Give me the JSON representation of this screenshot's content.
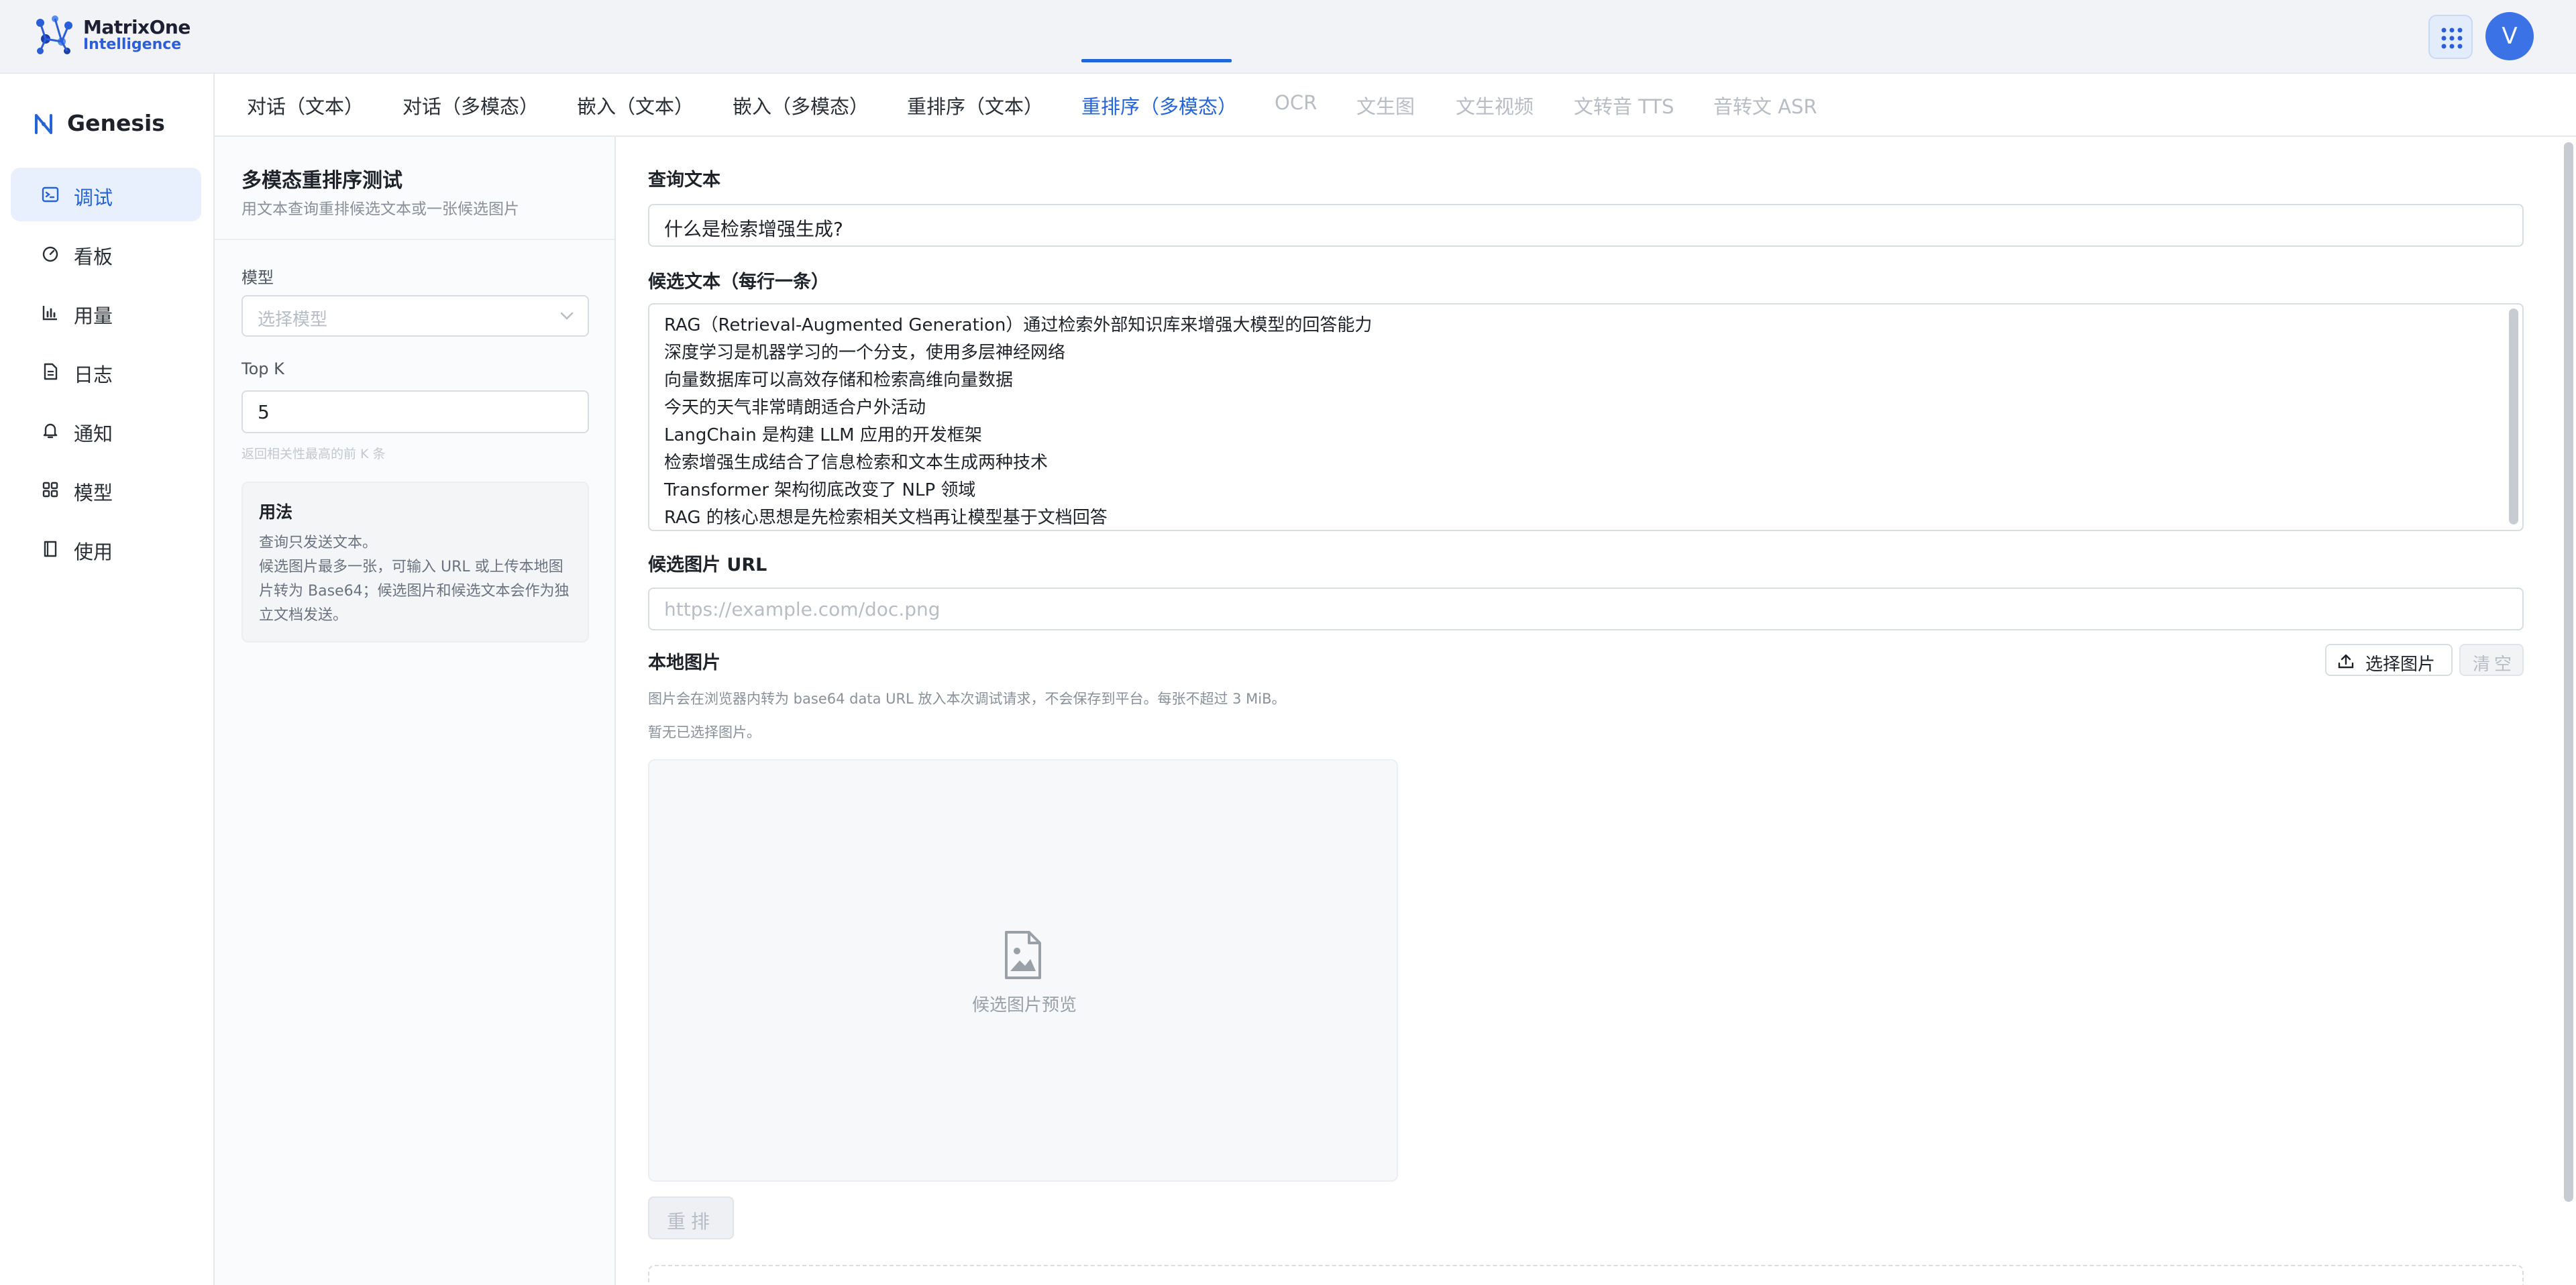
{
  "brand": {
    "logo_line1": "MatrixOne",
    "logo_line2": "Intelligence",
    "app_name": "Genesis"
  },
  "user": {
    "avatar_initial": "V"
  },
  "sidebar": {
    "items": [
      {
        "label": "调试",
        "icon": "terminal-icon",
        "active": true
      },
      {
        "label": "看板",
        "icon": "dashboard-gauge-icon"
      },
      {
        "label": "用量",
        "icon": "bar-chart-icon"
      },
      {
        "label": "日志",
        "icon": "document-icon"
      },
      {
        "label": "通知",
        "icon": "bell-icon"
      },
      {
        "label": "模型",
        "icon": "grid-icon"
      },
      {
        "label": "使用",
        "icon": "book-icon"
      }
    ]
  },
  "tabs": [
    {
      "label": "对话（文本）"
    },
    {
      "label": "对话（多模态）"
    },
    {
      "label": "嵌入（文本）"
    },
    {
      "label": "嵌入（多模态）"
    },
    {
      "label": "重排序（文本）"
    },
    {
      "label": "重排序（多模态）",
      "active": true
    },
    {
      "label": "OCR",
      "disabled": true
    },
    {
      "label": "文生图",
      "disabled": true
    },
    {
      "label": "文生视频",
      "disabled": true
    },
    {
      "label": "文转音 TTS",
      "disabled": true
    },
    {
      "label": "音转文 ASR",
      "disabled": true
    }
  ],
  "panel": {
    "title": "多模态重排序测试",
    "subtitle": "用文本查询重排候选文本或一张候选图片",
    "model_label": "模型",
    "model_placeholder": "选择模型",
    "topk_label": "Top K",
    "topk_value": "5",
    "topk_hint": "返回相关性最高的前 K 条",
    "usage_title": "用法",
    "usage_lines": [
      "查询只发送文本。",
      "候选图片最多一张，可输入 URL 或上传本地图",
      "片转为 Base64；候选图片和候选文本会作为独",
      "立文档发送。"
    ]
  },
  "main": {
    "query_label": "查询文本",
    "query_value": "什么是检索增强生成?",
    "candidates_label": "候选文本（每行一条）",
    "candidates": [
      "RAG（Retrieval-Augmented Generation）通过检索外部知识库来增强大模型的回答能力",
      "深度学习是机器学习的一个分支，使用多层神经网络",
      "向量数据库可以高效存储和检索高维向量数据",
      "今天的天气非常晴朗适合户外活动",
      "LangChain 是构建 LLM 应用的开发框架",
      "检索增强生成结合了信息检索和文本生成两种技术",
      "Transformer 架构彻底改变了 NLP 领域",
      "RAG 的核心思想是先检索相关文档再让模型基于文档回答"
    ],
    "image_url_label": "候选图片 URL",
    "image_url_placeholder": "https://example.com/doc.png",
    "local_image_label": "本地图片",
    "select_image_button": "选择图片",
    "clear_button": "清空",
    "local_image_note": "图片会在浏览器内转为 base64 data URL 放入本次调试请求，不会保存到平台。每张不超过 3 MiB。",
    "no_image_text": "暂无已选择图片。",
    "preview_text": "候选图片预览",
    "rerank_button": "重排"
  },
  "colors": {
    "accent": "#2563d9",
    "active_bg": "#e8f0fd",
    "topbar_bg": "#f2f3f6"
  }
}
